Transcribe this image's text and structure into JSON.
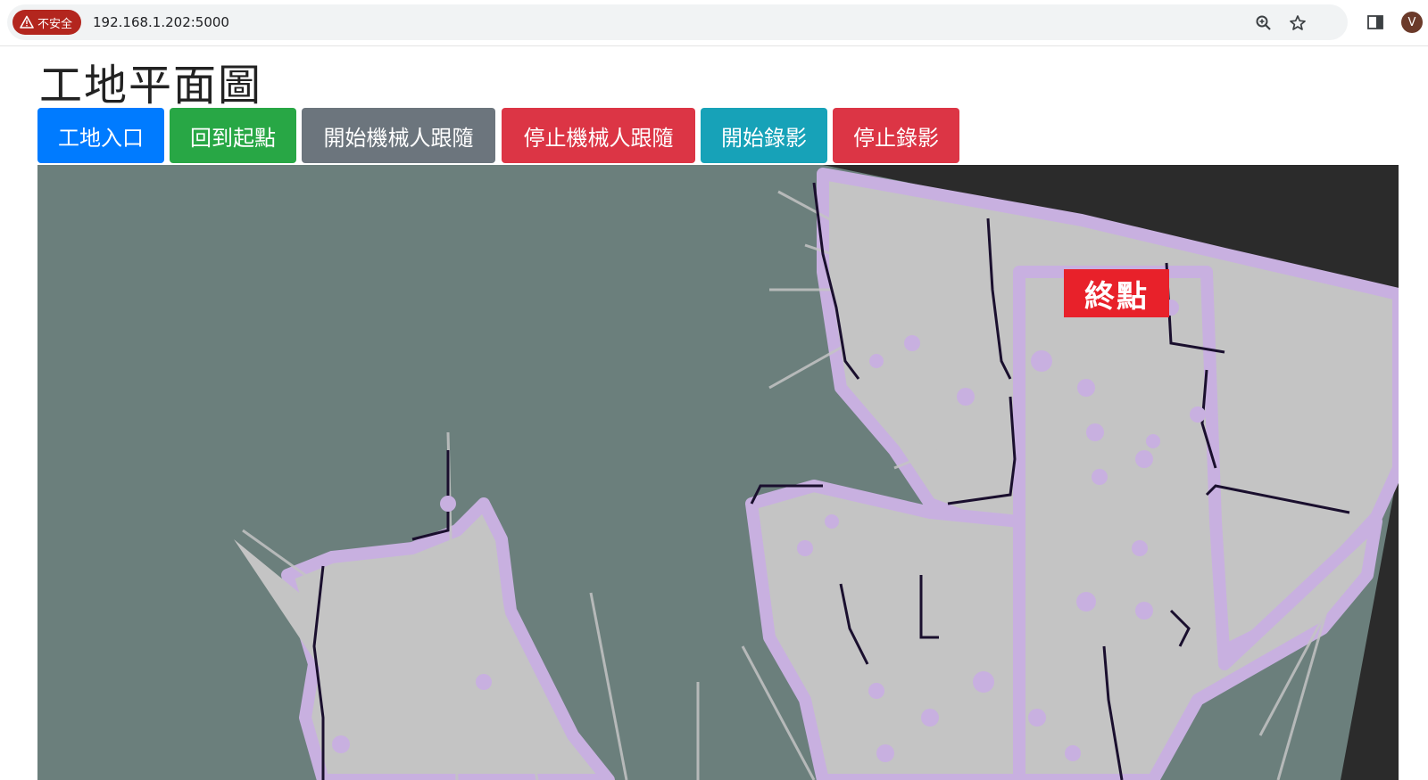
{
  "browser": {
    "security_label": "不安全",
    "url": "192.168.1.202:5000",
    "profile_initial": "V"
  },
  "page": {
    "title": "工地平面圖"
  },
  "toolbar": {
    "buttons": [
      {
        "label": "工地入口",
        "style": "primary",
        "color": "#007bff"
      },
      {
        "label": "回到起點",
        "style": "success",
        "color": "#28a745"
      },
      {
        "label": "開始機械人跟隨",
        "style": "secondary",
        "color": "#6c757d"
      },
      {
        "label": "停止機械人跟隨",
        "style": "danger",
        "color": "#dc3545"
      },
      {
        "label": "開始錄影",
        "style": "info",
        "color": "#17a2b8"
      },
      {
        "label": "停止錄影",
        "style": "danger",
        "color": "#dc3545"
      }
    ]
  },
  "map": {
    "goal_label": "終點",
    "colors": {
      "unknown": "#6b7f7c",
      "outside": "#2b2b2b",
      "free": "#c4c4c4",
      "inflation": "#c8b0e0",
      "obstacle": "#1a0f2e",
      "goal": "#e8212a"
    }
  }
}
